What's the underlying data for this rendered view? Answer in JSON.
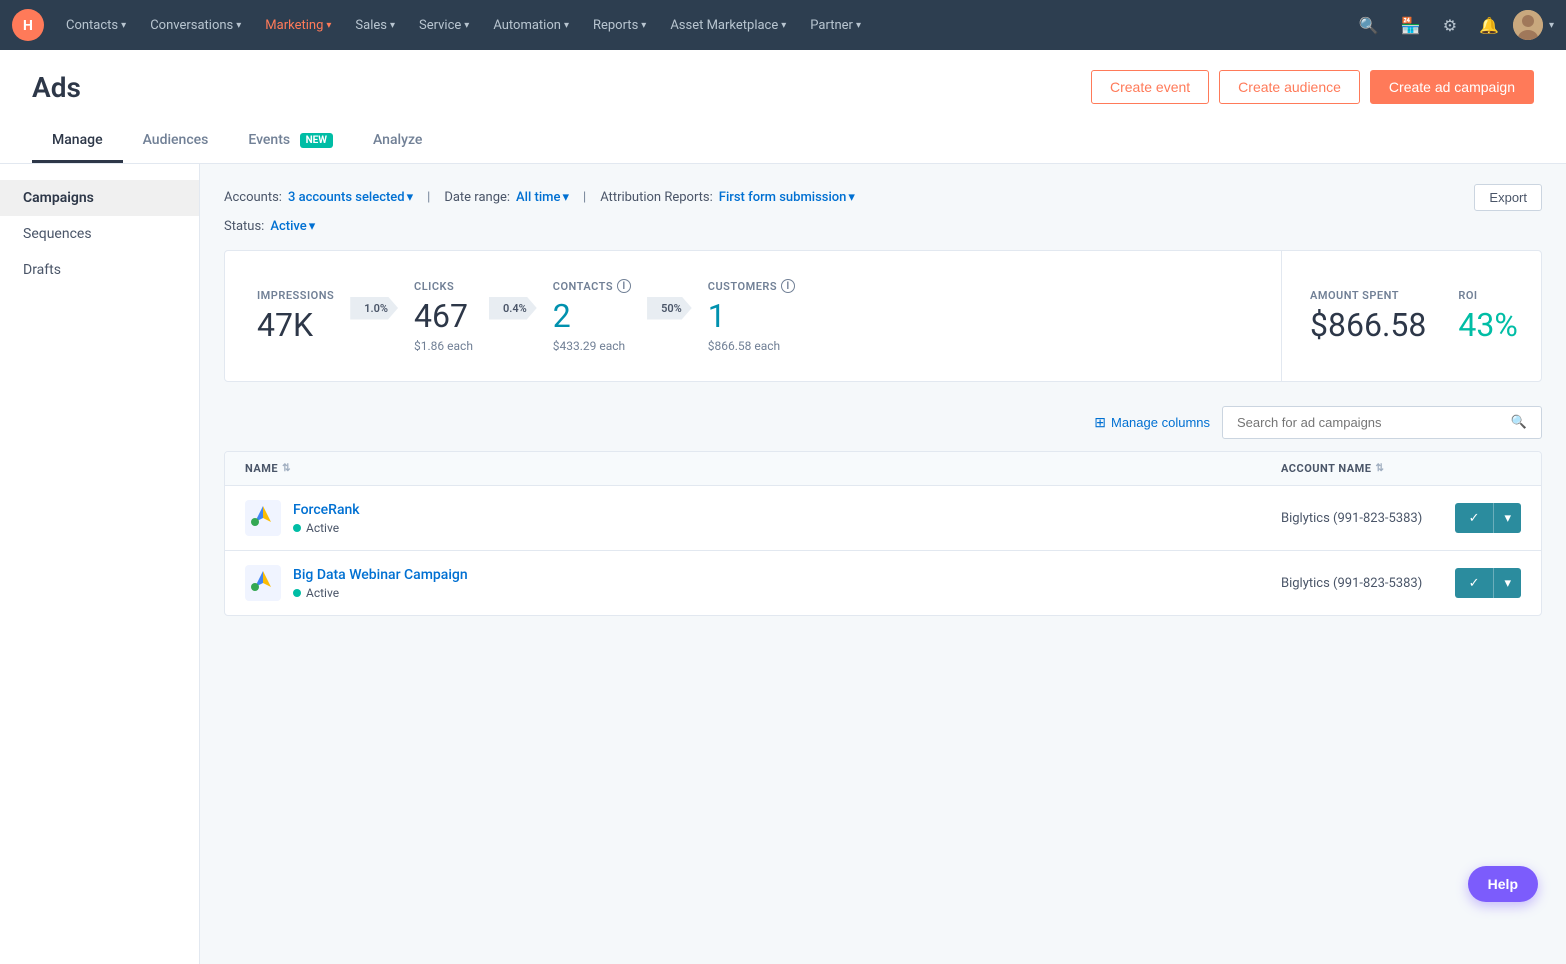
{
  "topnav": {
    "logo_label": "HubSpot",
    "items": [
      {
        "label": "Contacts",
        "has_chevron": true
      },
      {
        "label": "Conversations",
        "has_chevron": true
      },
      {
        "label": "Marketing",
        "has_chevron": true,
        "active": true
      },
      {
        "label": "Sales",
        "has_chevron": true
      },
      {
        "label": "Service",
        "has_chevron": true
      },
      {
        "label": "Automation",
        "has_chevron": true
      },
      {
        "label": "Reports",
        "has_chevron": true
      },
      {
        "label": "Asset Marketplace",
        "has_chevron": true
      },
      {
        "label": "Partner",
        "has_chevron": true
      }
    ],
    "icons": [
      "search",
      "marketplace",
      "settings",
      "notifications"
    ],
    "chevron_label": "▾"
  },
  "page": {
    "title": "Ads",
    "buttons": {
      "create_event": "Create event",
      "create_audience": "Create audience",
      "create_campaign": "Create ad campaign"
    },
    "tabs": [
      {
        "label": "Manage",
        "active": true,
        "badge": null
      },
      {
        "label": "Audiences",
        "active": false,
        "badge": null
      },
      {
        "label": "Events",
        "active": false,
        "badge": "NEW"
      },
      {
        "label": "Analyze",
        "active": false,
        "badge": null
      }
    ]
  },
  "sidebar": {
    "items": [
      {
        "label": "Campaigns",
        "active": true
      },
      {
        "label": "Sequences",
        "active": false
      },
      {
        "label": "Drafts",
        "active": false
      }
    ]
  },
  "filters": {
    "accounts_label": "Accounts:",
    "accounts_value": "3 accounts selected",
    "date_range_label": "Date range:",
    "date_range_value": "All time",
    "attribution_label": "Attribution Reports:",
    "attribution_value": "First form submission",
    "status_label": "Status:",
    "status_value": "Active",
    "export_label": "Export"
  },
  "stats": {
    "impressions": {
      "label": "IMPRESSIONS",
      "value": "47K",
      "rate": "1.0%"
    },
    "clicks": {
      "label": "CLICKS",
      "value": "467",
      "rate": "0.4%",
      "sub": "$1.86 each"
    },
    "contacts": {
      "label": "CONTACTS",
      "value": "2",
      "rate": "50%",
      "sub": "$433.29 each"
    },
    "customers": {
      "label": "CUSTOMERS",
      "value": "1",
      "sub": "$866.58 each"
    },
    "amount_spent": {
      "label": "AMOUNT SPENT",
      "value": "$866.58"
    },
    "roi": {
      "label": "ROI",
      "value": "43%"
    }
  },
  "table": {
    "manage_columns_label": "Manage columns",
    "search_placeholder": "Search for ad campaigns",
    "columns": [
      {
        "label": "NAME",
        "sortable": true
      },
      {
        "label": "ACCOUNT NAME",
        "sortable": true
      }
    ],
    "rows": [
      {
        "name": "ForceRank",
        "status": "Active",
        "account": "Biglytics (991-823-5383)"
      },
      {
        "name": "Big Data Webinar Campaign",
        "status": "Active",
        "account": "Biglytics (991-823-5383)"
      }
    ]
  },
  "help": {
    "label": "Help"
  }
}
